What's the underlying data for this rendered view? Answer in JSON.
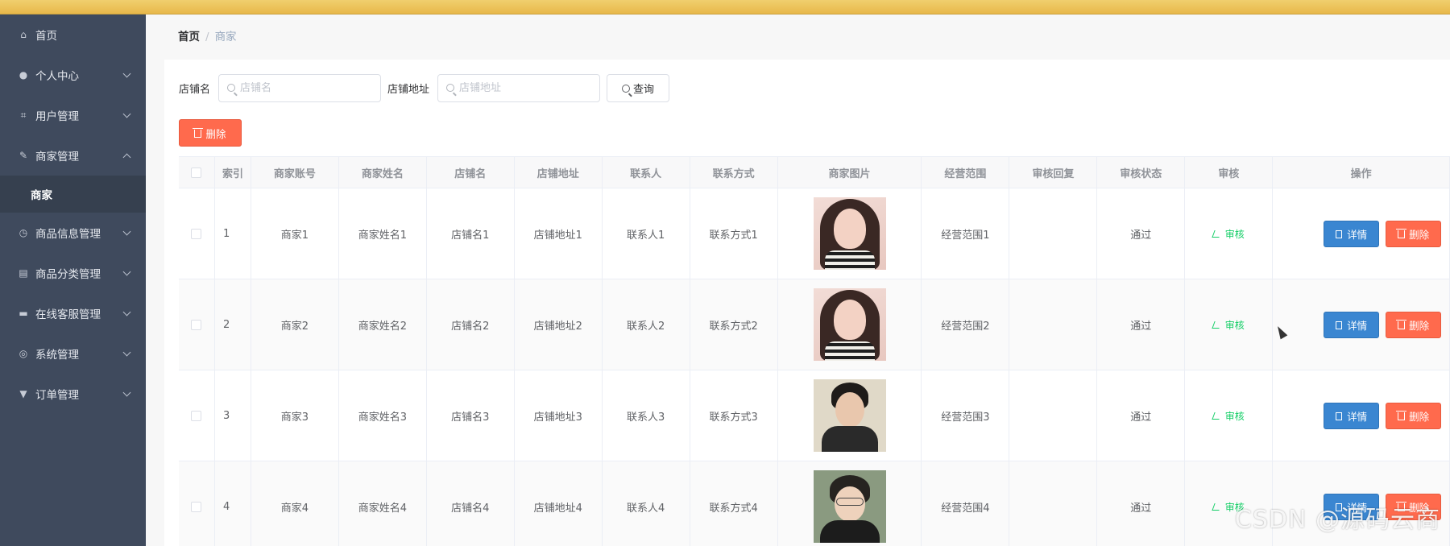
{
  "sidebar": {
    "items": [
      {
        "label": "首页",
        "icon": "home-icon"
      },
      {
        "label": "个人中心",
        "icon": "user-icon"
      },
      {
        "label": "用户管理",
        "icon": "crop-icon"
      },
      {
        "label": "商家管理",
        "icon": "edit-icon"
      },
      {
        "label": "商家"
      },
      {
        "label": "商品信息管理",
        "icon": "clock-icon"
      },
      {
        "label": "商品分类管理",
        "icon": "clipboard-icon"
      },
      {
        "label": "在线客服管理",
        "icon": "monitor-icon"
      },
      {
        "label": "系统管理",
        "icon": "target-icon"
      },
      {
        "label": "订单管理",
        "icon": "stamp-icon"
      }
    ]
  },
  "breadcrumb": {
    "home": "首页",
    "separator": "/",
    "current": "商家"
  },
  "search": {
    "shop_name_label": "店铺名",
    "shop_name_placeholder": "店铺名",
    "shop_addr_label": "店铺地址",
    "shop_addr_placeholder": "店铺地址",
    "query_label": "查询"
  },
  "toolbar": {
    "delete_label": "删除"
  },
  "table": {
    "headers": [
      "",
      "索引",
      "商家账号",
      "商家姓名",
      "店铺名",
      "店铺地址",
      "联系人",
      "联系方式",
      "商家图片",
      "经营范围",
      "审核回复",
      "审核状态",
      "审核",
      "操作"
    ],
    "rows": [
      {
        "index": "1",
        "account": "商家1",
        "name": "商家姓名1",
        "shop": "店铺名1",
        "address": "店铺地址1",
        "contact": "联系人1",
        "phone": "联系方式1",
        "scope": "经营范围1",
        "reply": "",
        "status": "通过",
        "audit": "审核",
        "detail": "详情",
        "delete": "删除"
      },
      {
        "index": "2",
        "account": "商家2",
        "name": "商家姓名2",
        "shop": "店铺名2",
        "address": "店铺地址2",
        "contact": "联系人2",
        "phone": "联系方式2",
        "scope": "经营范围2",
        "reply": "",
        "status": "通过",
        "audit": "审核",
        "detail": "详情",
        "delete": "删除"
      },
      {
        "index": "3",
        "account": "商家3",
        "name": "商家姓名3",
        "shop": "店铺名3",
        "address": "店铺地址3",
        "contact": "联系人3",
        "phone": "联系方式3",
        "scope": "经营范围3",
        "reply": "",
        "status": "通过",
        "audit": "审核",
        "detail": "详情",
        "delete": "删除"
      },
      {
        "index": "4",
        "account": "商家4",
        "name": "商家姓名4",
        "shop": "店铺名4",
        "address": "店铺地址4",
        "contact": "联系人4",
        "phone": "联系方式4",
        "scope": "经营范围4",
        "reply": "",
        "status": "通过",
        "audit": "审核",
        "detail": "详情",
        "delete": "删除"
      }
    ]
  },
  "watermark": "CSDN @源码云商",
  "colors": {
    "sidebar_bg": "#3f4a5d",
    "danger": "#ff6a4d",
    "primary": "#3a86d1",
    "success": "#13ce66",
    "topbar": "#e8b84a"
  }
}
